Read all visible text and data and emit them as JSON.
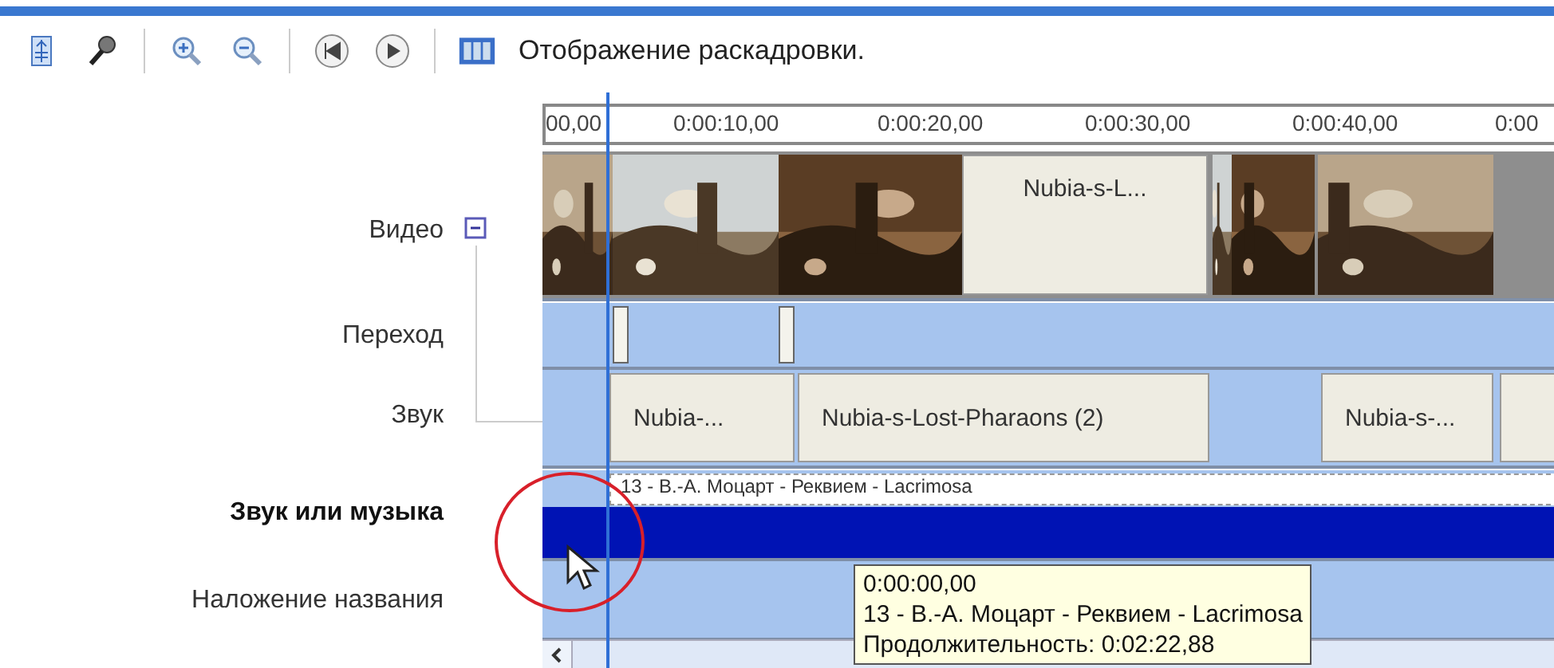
{
  "toolbar": {
    "storyboard_label": "Отображение раскадровки."
  },
  "ruler": {
    "ticks": [
      "00,00",
      "0:00:10,00",
      "0:00:20,00",
      "0:00:30,00",
      "0:00:40,00",
      "0:00"
    ]
  },
  "video_expander": {
    "expanded": true
  },
  "tracks": [
    {
      "label": "Видео",
      "selected": false,
      "clips": [
        {
          "kind": "picture"
        },
        {
          "kind": "picture"
        },
        {
          "kind": "picture"
        },
        {
          "kind": "title",
          "text": "Nubia-s-L..."
        },
        {
          "kind": "picture"
        },
        {
          "kind": "picture"
        },
        {
          "kind": "picture"
        }
      ]
    },
    {
      "label": "Переход",
      "selected": false,
      "clips": [
        {
          "kind": "transition"
        },
        {
          "kind": "transition"
        }
      ]
    },
    {
      "label": "Звук",
      "selected": false,
      "clips": [
        {
          "kind": "audio",
          "text": "Nubia-..."
        },
        {
          "kind": "audio",
          "text": "Nubia-s-Lost-Pharaons (2)"
        },
        {
          "kind": "audio",
          "text": "Nubia-s-..."
        },
        {
          "kind": "audio"
        }
      ]
    },
    {
      "label": "Звук или музыка",
      "selected": true,
      "clips": [
        {
          "kind": "music",
          "text": "13 - В.-А. Моцарт - Реквием - Lacrimosa"
        }
      ]
    },
    {
      "label": "Наложение названия",
      "selected": false
    }
  ],
  "tooltip": {
    "lines": [
      "0:00:00,00",
      "13 - В.-А. Моцарт - Реквием - Lacrimosa",
      "Продолжительность:  0:02:22,88"
    ]
  }
}
